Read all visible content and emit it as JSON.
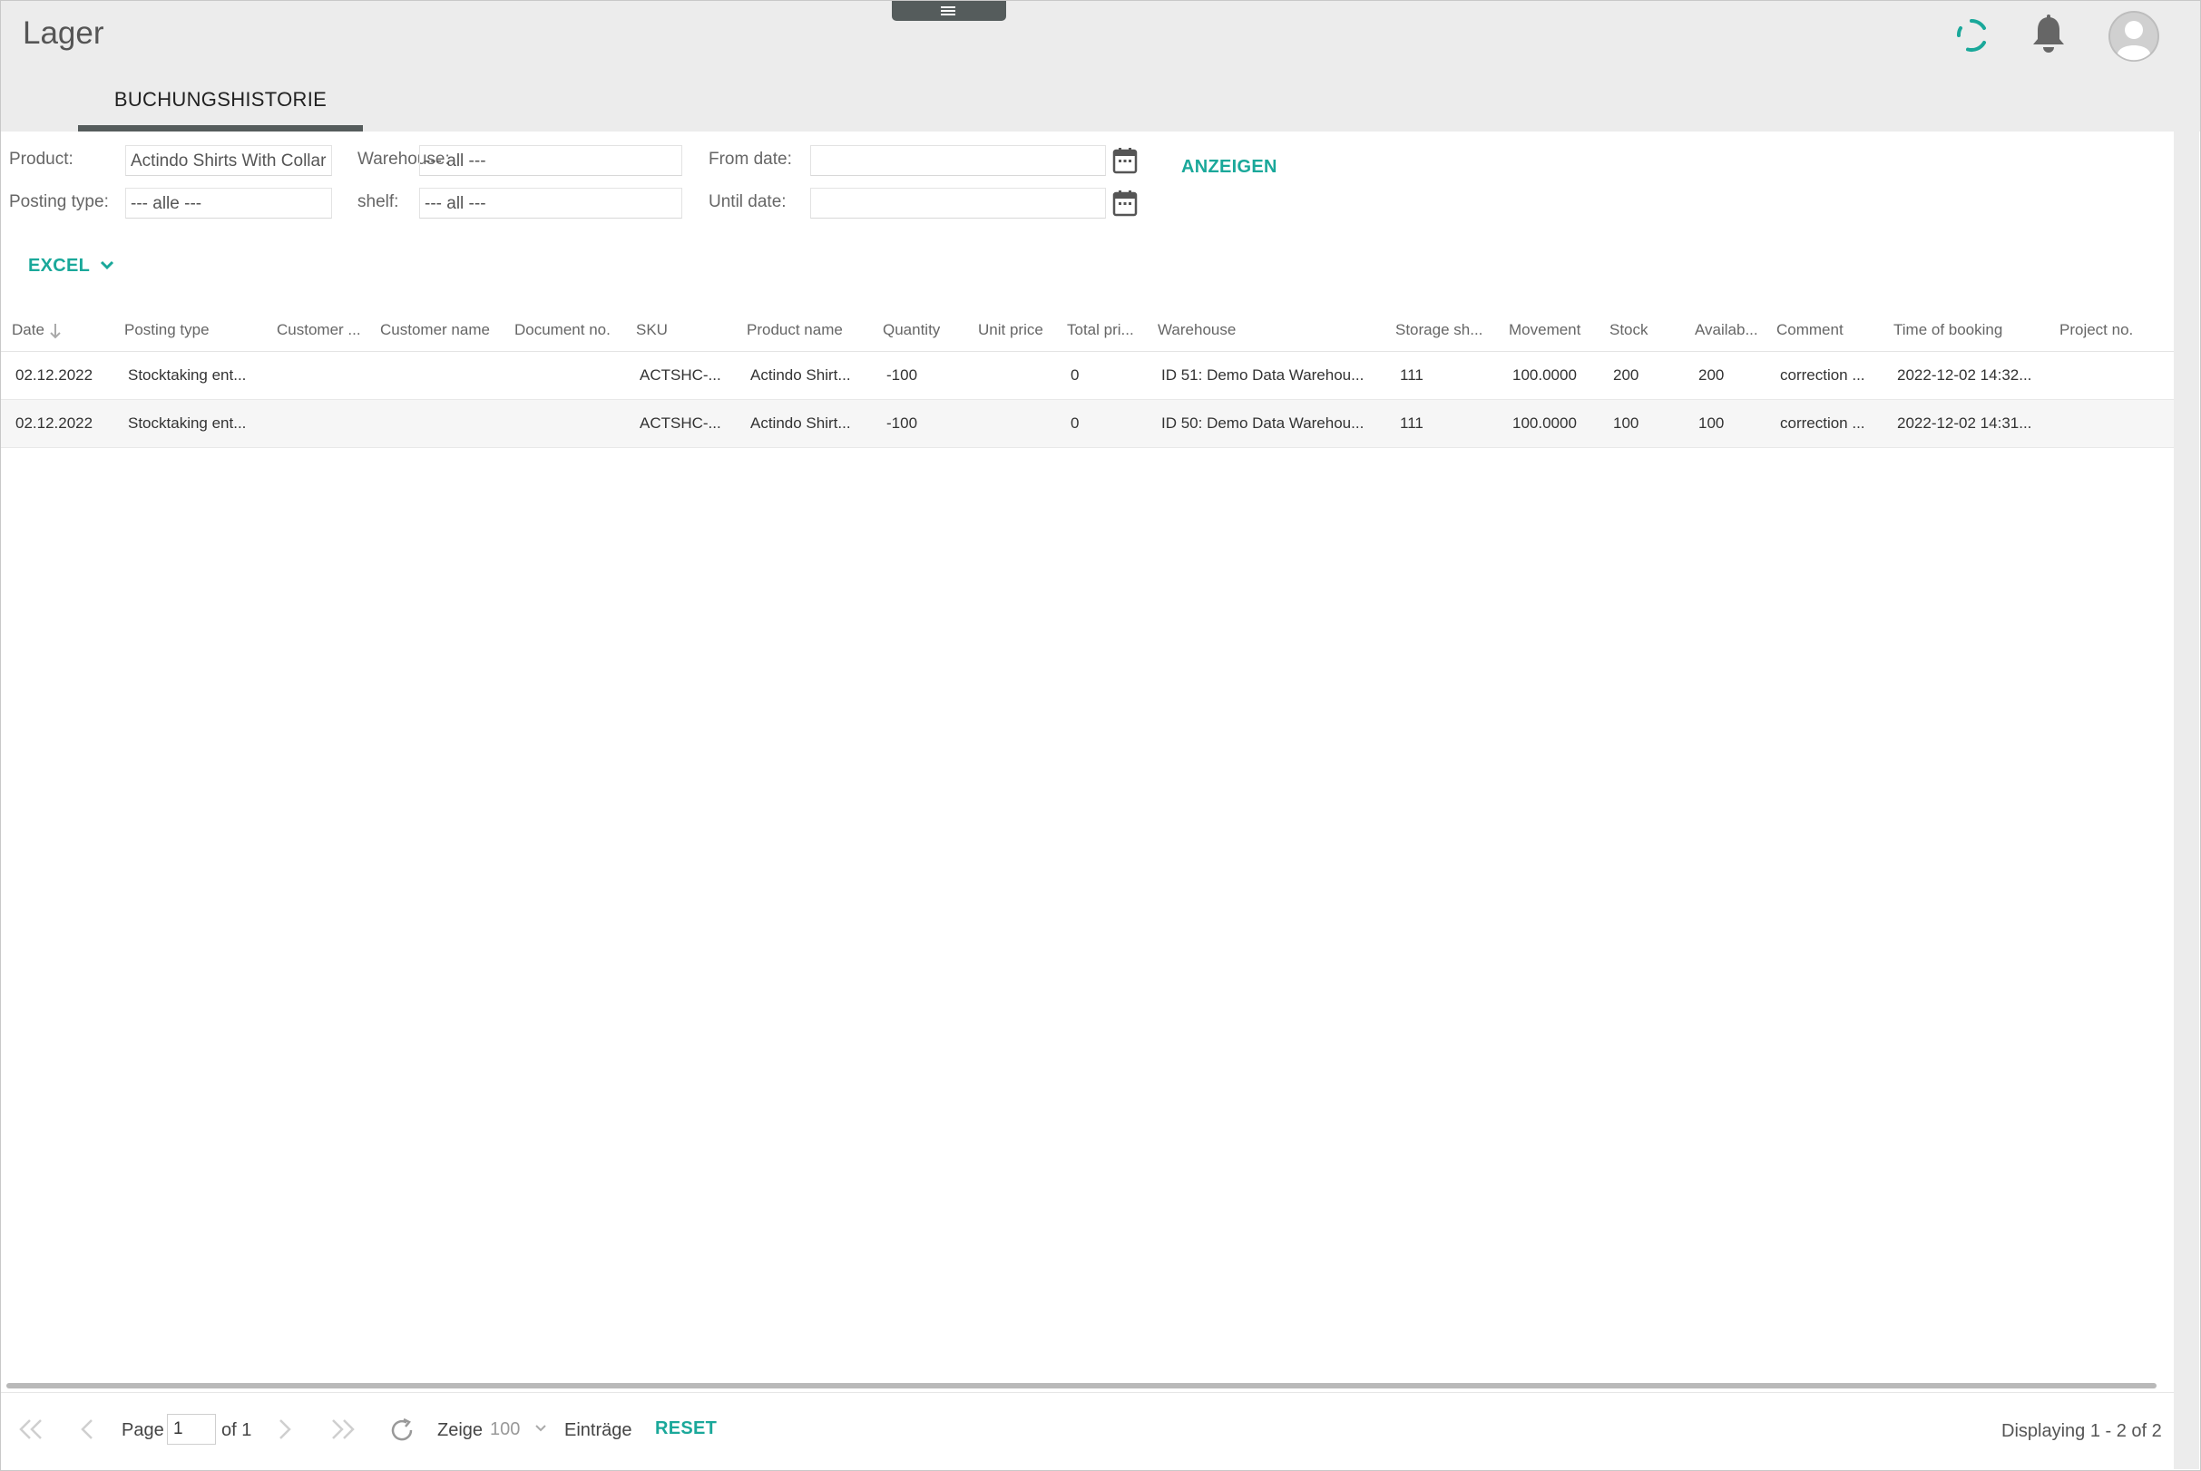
{
  "app": {
    "title": "Lager"
  },
  "tabs": [
    {
      "label": "BUCHUNGSHISTORIE",
      "active": true
    }
  ],
  "filters": {
    "product_label": "Product:",
    "product_value": "Actindo Shirts With Collar",
    "warehouse_label": "Warehouse:",
    "warehouse_value": "--- all ---",
    "from_date_label": "From date:",
    "from_date_value": "",
    "posting_type_label": "Posting type:",
    "posting_type_value": "--- alle ---",
    "shelf_label": "shelf:",
    "shelf_value": "--- all ---",
    "until_date_label": "Until date:",
    "until_date_value": "",
    "show_button": "ANZEIGEN"
  },
  "toolbar": {
    "excel_label": "EXCEL"
  },
  "grid": {
    "sort_column": "Date",
    "sort_direction": "descending",
    "columns": [
      "Date",
      "Posting type",
      "Customer ...",
      "Customer name",
      "Document no.",
      "SKU",
      "Product name",
      "Quantity",
      "Unit price",
      "Total pri...",
      "Warehouse",
      "Storage sh...",
      "Movement",
      "Stock",
      "Availab...",
      "Comment",
      "Time of booking",
      "Project no."
    ],
    "rows": [
      [
        "02.12.2022",
        "Stocktaking ent...",
        "",
        "",
        "",
        "ACTSHC-...",
        "Actindo Shirt...",
        "-100",
        "",
        "0",
        "ID 51: Demo Data Warehou...",
        "111",
        "100.0000",
        "200",
        "200",
        "correction ...",
        "2022-12-02 14:32...",
        ""
      ],
      [
        "02.12.2022",
        "Stocktaking ent...",
        "",
        "",
        "",
        "ACTSHC-...",
        "Actindo Shirt...",
        "-100",
        "",
        "0",
        "ID 50: Demo Data Warehou...",
        "111",
        "100.0000",
        "100",
        "100",
        "correction ...",
        "2022-12-02 14:31...",
        ""
      ]
    ]
  },
  "pager": {
    "page_label": "Page",
    "page_value": "1",
    "of_label": "of 1",
    "show_label": "Zeige",
    "page_size": "100",
    "entries_label": "Einträge",
    "reset_label": "RESET",
    "displaying": "Displaying 1 - 2 of 2"
  },
  "colors": {
    "accent": "#1aa89a",
    "header_bg": "#ececec",
    "tab_underline": "#555c5c"
  }
}
